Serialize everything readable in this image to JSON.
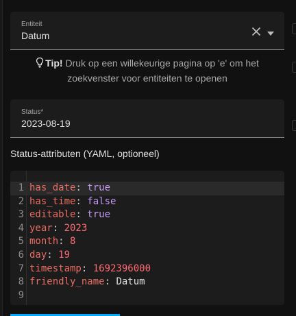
{
  "entity_field": {
    "label": "Entiteit",
    "value": "Datum"
  },
  "tip": {
    "title": "Tip!",
    "text": "Druk op een willekeurige pagina op 'e' om het zoekvenster voor entiteiten te openen"
  },
  "status_field": {
    "label": "Status*",
    "value": "2023-08-19"
  },
  "attributes_heading": "Status-attributen (YAML, optioneel)",
  "code_editor": {
    "active_line": 1,
    "lines": [
      {
        "n": "1",
        "key": "has_date",
        "sep": ": ",
        "value": "true",
        "type": "kw"
      },
      {
        "n": "2",
        "key": "has_time",
        "sep": ": ",
        "value": "false",
        "type": "kw"
      },
      {
        "n": "3",
        "key": "editable",
        "sep": ": ",
        "value": "true",
        "type": "kw"
      },
      {
        "n": "4",
        "key": "year",
        "sep": ": ",
        "value": "2023",
        "type": "num"
      },
      {
        "n": "5",
        "key": "month",
        "sep": ": ",
        "value": "8",
        "type": "num"
      },
      {
        "n": "6",
        "key": "day",
        "sep": ": ",
        "value": "19",
        "type": "num"
      },
      {
        "n": "7",
        "key": "timestamp",
        "sep": ": ",
        "value": "1692396000",
        "type": "num"
      },
      {
        "n": "8",
        "key": "friendly_name",
        "sep": ": ",
        "value": "Datum",
        "type": "str"
      },
      {
        "n": "9",
        "key": "",
        "sep": "",
        "value": "",
        "type": "str"
      }
    ]
  },
  "colors": {
    "accent": "#03a9f4",
    "yaml_key": "#e96e63",
    "yaml_bool": "#c59bf3",
    "yaml_number": "#ff6b74"
  },
  "icons": {
    "clear": "close-icon",
    "dropdown": "menu-down-icon",
    "tip": "lightbulb-icon"
  }
}
